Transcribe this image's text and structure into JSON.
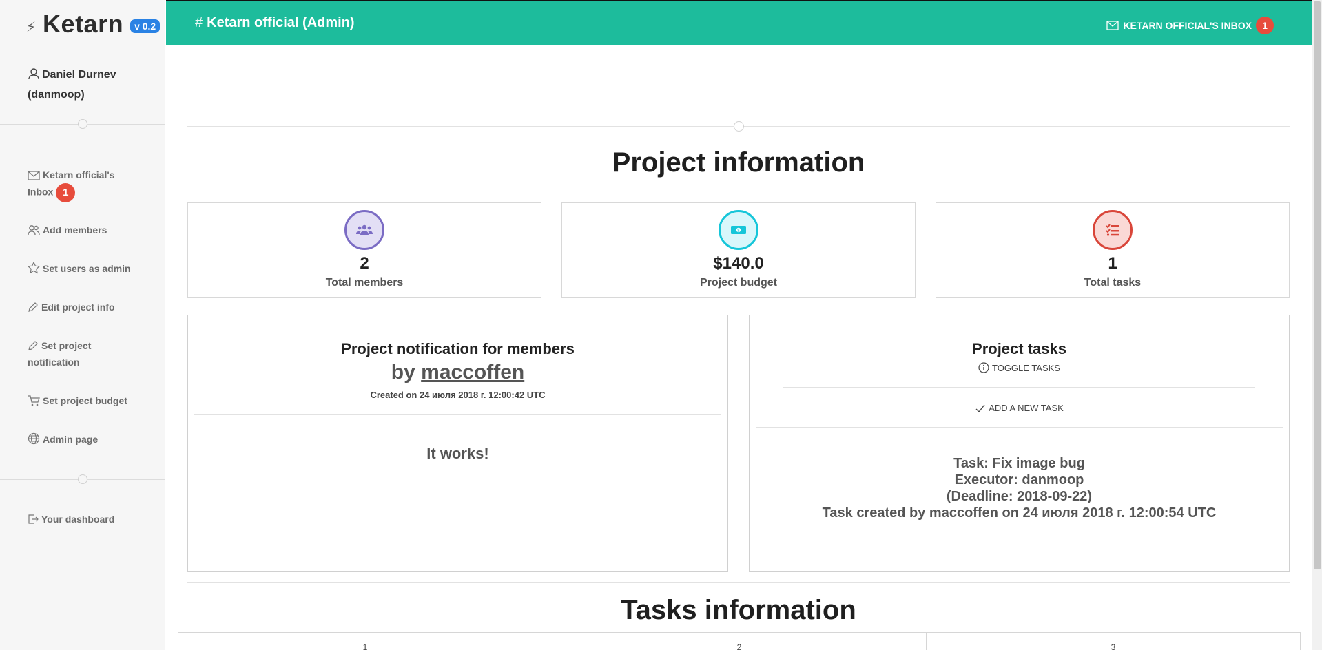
{
  "sidebar": {
    "brand": "Ketarn",
    "version": "v 0.2",
    "user": "Daniel Durnev (danmoop)",
    "items": [
      {
        "label": "Ketarn official's Inbox",
        "badge": "1",
        "icon": "envelope-icon"
      },
      {
        "label": "Add members",
        "icon": "users-icon"
      },
      {
        "label": "Set users as admin",
        "icon": "star-icon"
      },
      {
        "label": "Edit project info",
        "icon": "pencil-icon"
      },
      {
        "label": "Set project notification",
        "icon": "pencil-icon"
      },
      {
        "label": "Set project budget",
        "icon": "cart-icon"
      },
      {
        "label": "Admin page",
        "icon": "globe-icon"
      }
    ],
    "footer_item": {
      "label": "Your dashboard",
      "icon": "sign-out-icon"
    }
  },
  "topbar": {
    "title": "Ketarn official (Admin)",
    "inbox_label": "KETARN OFFICIAL'S INBOX",
    "inbox_badge": "1",
    "color": "#1dbc9c"
  },
  "main": {
    "project_heading": "Project information",
    "stats": [
      {
        "value": "2",
        "label": "Total members",
        "icon": "users-icon",
        "color": "#7b6cc4"
      },
      {
        "value": "$140.0",
        "label": "Project budget",
        "icon": "money-icon",
        "color": "#16c6d9"
      },
      {
        "value": "1",
        "label": "Total tasks",
        "icon": "tasks-icon",
        "color": "#d9463a"
      }
    ],
    "notification": {
      "title": "Project notification for members",
      "by_prefix": "by",
      "author": "maccoffen",
      "created": "Created on 24 июля 2018 г. 12:00:42 UTC",
      "message": "It works!"
    },
    "tasks": {
      "title": "Project tasks",
      "toggle": "TOGGLE TASKS",
      "add": "ADD A NEW TASK",
      "lines": [
        "Task: Fix image bug",
        "Executor: danmoop",
        "(Deadline: 2018-09-22)",
        "Task created by maccoffen on 24 июля 2018 г. 12:00:54 UTC"
      ]
    },
    "tasks_heading": "Tasks information",
    "tasks_columns": [
      "1",
      "2",
      "3"
    ]
  }
}
